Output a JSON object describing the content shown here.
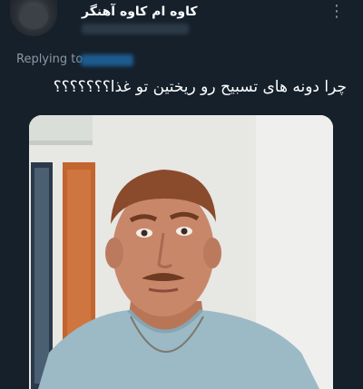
{
  "tweet": {
    "author_name": "کاوه ام کاوه آهنگر",
    "more_icon": "more-vertical-icon",
    "replying_label": "Replying to",
    "text": "چرا دونه های تسبیح رو ریختین تو غذا؟؟؟؟؟؟؟",
    "media": {
      "kind": "photo",
      "colors": {
        "wall": "#e7e7e4",
        "shirt": "#9cb9c6",
        "skin": "#c9876a",
        "hair": "#8a4a2c"
      }
    }
  }
}
